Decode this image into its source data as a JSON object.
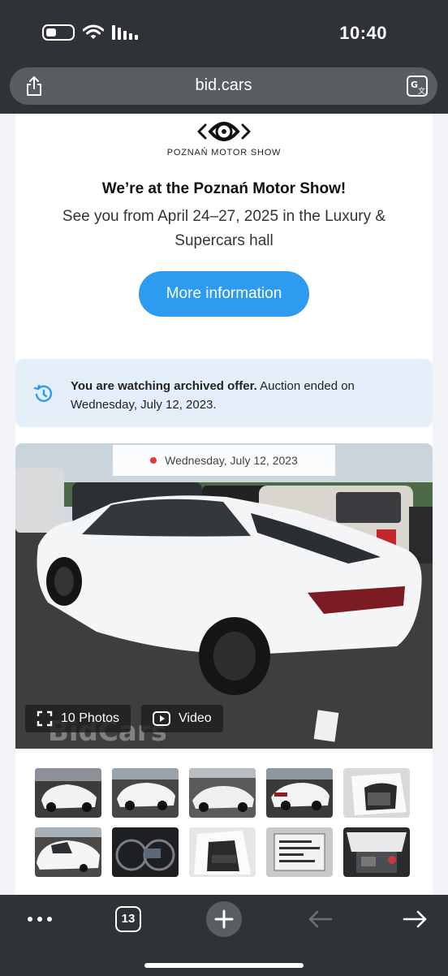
{
  "status_bar": {
    "time": "10:40"
  },
  "url_bar": {
    "url": "bid.cars"
  },
  "promo": {
    "logo_text": "POZNAŃ MOTOR SHOW",
    "title": "We’re at the Poznań Motor Show!",
    "subtitle": "See you from April 24–27, 2025 in the Luxury & Supercars hall",
    "button_label": "More information"
  },
  "archive_notice": {
    "bold_text": "You are watching archived offer.",
    "text": " Auction ended on Wednesday, July 12, 2023."
  },
  "listing": {
    "date": "Wednesday, July 12, 2023",
    "photos_label": "10 Photos",
    "video_label": "Video",
    "thumbnail_count": 10
  },
  "toolbar": {
    "tab_count": "13"
  },
  "colors": {
    "accent": "#2d9cf0",
    "chrome": "#2f3237",
    "notice_bg": "#e4eef9",
    "status_dot": "#e53935"
  }
}
